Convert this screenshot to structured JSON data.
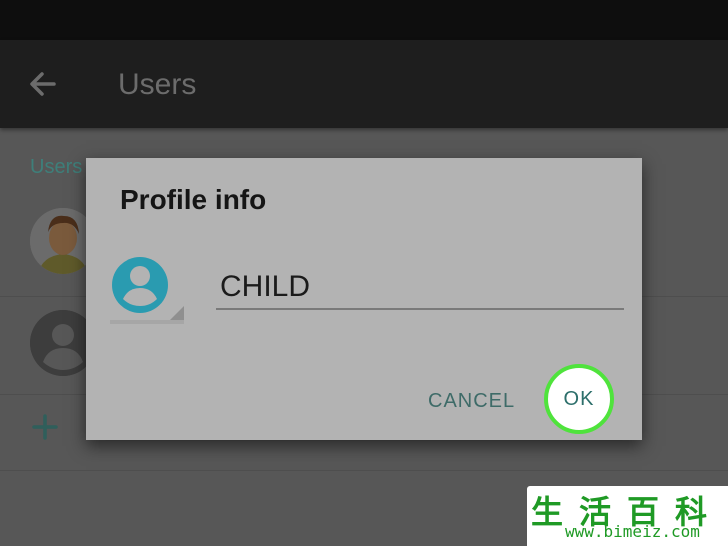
{
  "app_bar": {
    "title": "Users"
  },
  "users_section": {
    "label": "Users"
  },
  "dialog": {
    "title": "Profile info",
    "name_value": "CHILD",
    "cancel_label": "CANCEL",
    "ok_label": "OK"
  },
  "watermark": {
    "chars": "生活百科",
    "url": "www.bimeiz.com"
  },
  "colors": {
    "accent": "#3e7f7a",
    "avatar": "#2a9bb0",
    "ok_highlight": "#4fe33c",
    "watermark": "#1f9a25"
  }
}
